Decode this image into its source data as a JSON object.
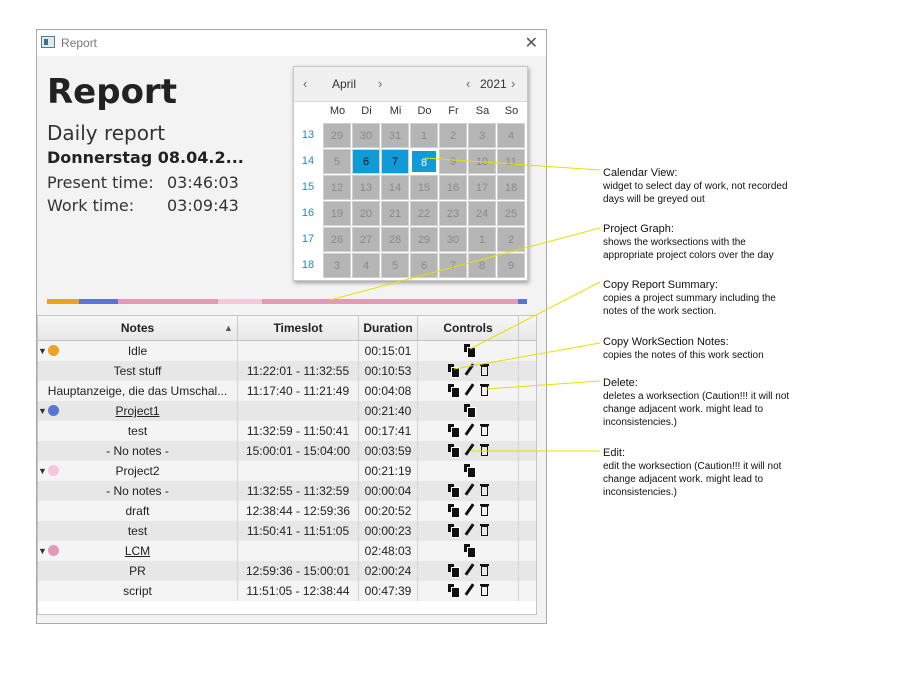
{
  "window": {
    "title": "Report"
  },
  "header": {
    "title": "Report",
    "subtitle": "Daily report",
    "date": "Donnerstag 08.04.2...",
    "present_label": "Present time:",
    "present_value": "03:46:03",
    "work_label": "Work time:",
    "work_value": "03:09:43"
  },
  "calendar": {
    "month": "April",
    "year": "2021",
    "weekdays": [
      "Mo",
      "Di",
      "Mi",
      "Do",
      "Fr",
      "Sa",
      "So"
    ],
    "weeks": [
      {
        "num": "13",
        "days": [
          "29",
          "30",
          "31",
          "1",
          "2",
          "3",
          "4"
        ]
      },
      {
        "num": "14",
        "days": [
          "5",
          "6",
          "7",
          "8",
          "9",
          "10",
          "11"
        ]
      },
      {
        "num": "15",
        "days": [
          "12",
          "13",
          "14",
          "15",
          "16",
          "17",
          "18"
        ]
      },
      {
        "num": "16",
        "days": [
          "19",
          "20",
          "21",
          "22",
          "23",
          "24",
          "25"
        ]
      },
      {
        "num": "17",
        "days": [
          "26",
          "27",
          "28",
          "29",
          "30",
          "1",
          "2"
        ]
      },
      {
        "num": "18",
        "days": [
          "3",
          "4",
          "5",
          "6",
          "7",
          "8",
          "9"
        ]
      }
    ],
    "recorded_days": [
      "6",
      "7",
      "8"
    ],
    "selected_day": "8"
  },
  "project_graph": {
    "segments": [
      {
        "color": "#f0a020",
        "fraction": 0.067
      },
      {
        "color": "#5b72d6",
        "fraction": 0.08
      },
      {
        "color": "#e29ab8",
        "fraction": 0.21
      },
      {
        "color": "#f6c7dc",
        "fraction": 0.09
      },
      {
        "color": "#e29ab8",
        "fraction": 0.535
      },
      {
        "color": "#5b72d6",
        "fraction": 0.018
      }
    ]
  },
  "table": {
    "columns": {
      "notes": "Notes",
      "timeslot": "Timeslot",
      "duration": "Duration",
      "controls": "Controls"
    },
    "rows": [
      {
        "type": "group",
        "notes": "Idle",
        "timeslot": "",
        "duration": "00:15:01",
        "dot": "#f0a020",
        "underline": false
      },
      {
        "type": "item",
        "notes": "Test stuff",
        "timeslot": "11:22:01 - 11:32:55",
        "duration": "00:10:53"
      },
      {
        "type": "item",
        "notes": "Hauptanzeige, die das Umschal...",
        "timeslot": "11:17:40 - 11:21:49",
        "duration": "00:04:08"
      },
      {
        "type": "group",
        "notes": "Project1",
        "timeslot": "",
        "duration": "00:21:40",
        "dot": "#5b72d6",
        "underline": true
      },
      {
        "type": "item",
        "notes": "test",
        "timeslot": "11:32:59 - 11:50:41",
        "duration": "00:17:41"
      },
      {
        "type": "item",
        "notes": "- No notes -",
        "timeslot": "15:00:01 - 15:04:00",
        "duration": "00:03:59"
      },
      {
        "type": "group",
        "notes": "Project2",
        "timeslot": "",
        "duration": "00:21:19",
        "dot": "#f6c7dc",
        "underline": false
      },
      {
        "type": "item",
        "notes": "- No notes -",
        "timeslot": "11:32:55 - 11:32:59",
        "duration": "00:00:04"
      },
      {
        "type": "item",
        "notes": "draft",
        "timeslot": "12:38:44 - 12:59:36",
        "duration": "00:20:52"
      },
      {
        "type": "item",
        "notes": "test",
        "timeslot": "11:50:41 - 11:51:05",
        "duration": "00:00:23"
      },
      {
        "type": "group",
        "notes": "LCM",
        "timeslot": "",
        "duration": "02:48:03",
        "dot": "#e29ab8",
        "underline": true
      },
      {
        "type": "item",
        "notes": "PR",
        "timeslot": "12:59:36 - 15:00:01",
        "duration": "02:00:24"
      },
      {
        "type": "item",
        "notes": "script",
        "timeslot": "11:51:05 - 12:38:44",
        "duration": "00:47:39"
      }
    ]
  },
  "annotations": [
    {
      "title": "Calendar View:",
      "text": "widget to select day of work, not recorded days will be greyed out"
    },
    {
      "title": "Project Graph:",
      "text": "shows the worksections with the appropriate project colors over the day"
    },
    {
      "title": "Copy Report Summary:",
      "text": "copies a project summary including the notes of the work section."
    },
    {
      "title": "Copy WorkSection Notes:",
      "text": "copies the notes of this work section"
    },
    {
      "title": "Delete:",
      "text": "deletes a worksection (Caution!!! it will not change adjacent work. might lead to inconsistencies.)"
    },
    {
      "title": "Edit:",
      "text": "edit the worksection (Caution!!! it will not change adjacent work. might lead to inconsistencies.)"
    }
  ],
  "icons": {
    "expand": "triangle-down-icon",
    "sort": "sort-ascending-icon",
    "copy": "copy-icon",
    "edit": "pencil-icon",
    "delete": "trash-icon"
  }
}
